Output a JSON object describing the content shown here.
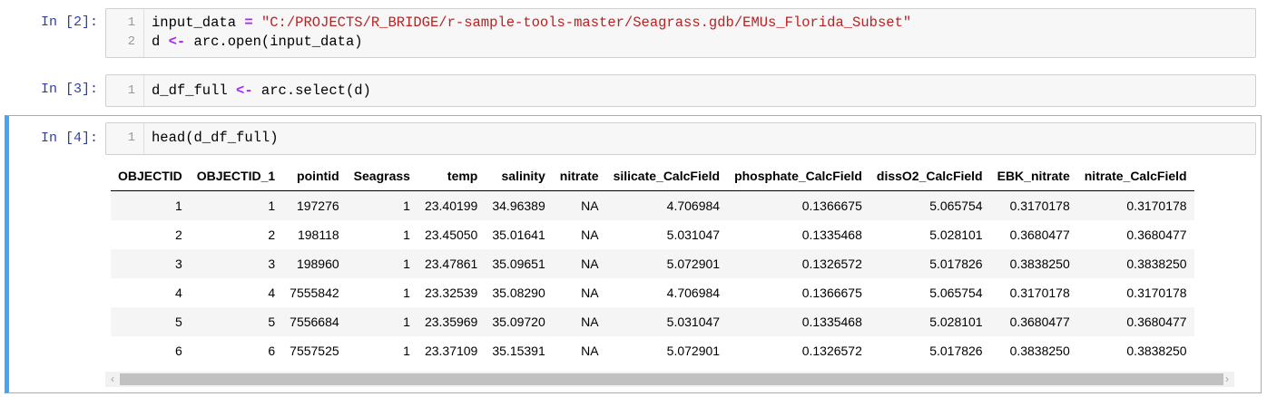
{
  "cells": [
    {
      "prompt": "In [2]:",
      "lines": [
        {
          "num": "1",
          "pre": "input_data ",
          "op": "=",
          "post": " ",
          "str": "\"C:/PROJECTS/R_BRIDGE/r-sample-tools-master/Seagrass.gdb/EMUs_Florida_Subset\""
        },
        {
          "num": "2",
          "pre": "d ",
          "op": "<-",
          "post": " arc.open(input_data)",
          "str": ""
        }
      ]
    },
    {
      "prompt": "In [3]:",
      "lines": [
        {
          "num": "1",
          "pre": "d_df_full ",
          "op": "<-",
          "post": " arc.select(d)",
          "str": ""
        }
      ]
    },
    {
      "prompt": "In [4]:",
      "lines": [
        {
          "num": "1",
          "pre": "head(d_df_full)",
          "op": "",
          "post": "",
          "str": ""
        }
      ]
    }
  ],
  "table": {
    "headers": [
      "OBJECTID",
      "OBJECTID_1",
      "pointid",
      "Seagrass",
      "temp",
      "salinity",
      "nitrate",
      "silicate_CalcField",
      "phosphate_CalcField",
      "dissO2_CalcField",
      "EBK_nitrate",
      "nitrate_CalcField"
    ],
    "rows": [
      [
        "1",
        "1",
        "197276",
        "1",
        "23.40199",
        "34.96389",
        "NA",
        "4.706984",
        "0.1366675",
        "5.065754",
        "0.3170178",
        "0.3170178"
      ],
      [
        "2",
        "2",
        "198118",
        "1",
        "23.45050",
        "35.01641",
        "NA",
        "5.031047",
        "0.1335468",
        "5.028101",
        "0.3680477",
        "0.3680477"
      ],
      [
        "3",
        "3",
        "198960",
        "1",
        "23.47861",
        "35.09651",
        "NA",
        "5.072901",
        "0.1326572",
        "5.017826",
        "0.3838250",
        "0.3838250"
      ],
      [
        "4",
        "4",
        "7555842",
        "1",
        "23.32539",
        "35.08290",
        "NA",
        "4.706984",
        "0.1366675",
        "5.065754",
        "0.3170178",
        "0.3170178"
      ],
      [
        "5",
        "5",
        "7556684",
        "1",
        "23.35969",
        "35.09720",
        "NA",
        "5.031047",
        "0.1335468",
        "5.028101",
        "0.3680477",
        "0.3680477"
      ],
      [
        "6",
        "6",
        "7557525",
        "1",
        "23.37109",
        "35.15391",
        "NA",
        "5.072901",
        "0.1326572",
        "5.017826",
        "0.3838250",
        "0.3838250"
      ]
    ]
  },
  "scrollbar": {
    "left_arrow": "‹",
    "right_arrow": "›"
  }
}
